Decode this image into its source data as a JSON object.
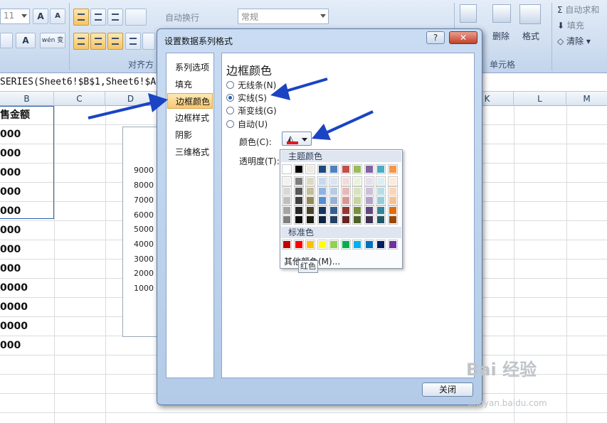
{
  "ribbon": {
    "font_size": "11",
    "wrap_text": "自动换行",
    "number_format": "常规",
    "align_group": "对齐方",
    "cells_group": "单元格",
    "delete_label": "删除",
    "format_label": "格式",
    "autosum_label": "自动求和",
    "fill_label": "填充",
    "clear_label": "清除",
    "sigma_icon": "Σ",
    "font_a": "A",
    "phonetic": "wén 变"
  },
  "formula_bar": {
    "text": "SERIES(Sheet6!$B$1,Sheet6!$A"
  },
  "columns": [
    "B",
    "C",
    "D",
    "K",
    "L",
    "M"
  ],
  "sheet_cells": [
    "售金额",
    "000",
    "000",
    "000",
    "000",
    "000",
    "000",
    "000",
    "000",
    "0000",
    "0000",
    "0000",
    "000"
  ],
  "chart_ticks": [
    "9000",
    "8000",
    "7000",
    "6000",
    "5000",
    "4000",
    "3000",
    "2000",
    "1000"
  ],
  "dialog": {
    "title": "设置数据系列格式",
    "help": "?",
    "close": "✕",
    "nav": [
      "系列选项",
      "填充",
      "边框颜色",
      "边框样式",
      "阴影",
      "三维格式"
    ],
    "nav_active_index": 2,
    "section_title": "边框颜色",
    "options": [
      "无线条(N)",
      "实线(S)",
      "渐变线(G)",
      "自动(U)"
    ],
    "selected_option_index": 1,
    "color_label": "颜色(C):",
    "transparency_label": "透明度(T):",
    "close_button": "关闭"
  },
  "palette": {
    "theme_title": "主题颜色",
    "standard_title": "标准色",
    "more_colors": "其他颜色(M)...",
    "tooltip": "红色",
    "selected_color": "#e6151f",
    "theme_top": [
      "#ffffff",
      "#000000",
      "#eeece1",
      "#1f497d",
      "#4f81bd",
      "#c0504d",
      "#9bbb59",
      "#8064a2",
      "#4bacc6",
      "#f79646"
    ],
    "theme_shades": [
      [
        "#f2f2f2",
        "#7f7f7f",
        "#ddd9c3",
        "#c6d9f0",
        "#dbe5f1",
        "#f2dcdb",
        "#ebf1dd",
        "#e5e0ec",
        "#dbeef3",
        "#fdeada"
      ],
      [
        "#d8d8d8",
        "#595959",
        "#c4bd97",
        "#8db3e2",
        "#b8cce4",
        "#e5b9b7",
        "#d7e3bc",
        "#ccc1d9",
        "#b7dde8",
        "#fbd5b5"
      ],
      [
        "#bfbfbf",
        "#3f3f3f",
        "#938953",
        "#548dd4",
        "#95b3d7",
        "#d99694",
        "#c3d69b",
        "#b2a2c7",
        "#92cddc",
        "#fac08f"
      ],
      [
        "#a5a5a5",
        "#262626",
        "#494429",
        "#17365d",
        "#366092",
        "#953734",
        "#76923c",
        "#5f497a",
        "#31859b",
        "#e36c09"
      ],
      [
        "#7f7f7f",
        "#0c0c0c",
        "#1d1b10",
        "#0f243e",
        "#244061",
        "#632423",
        "#4f6128",
        "#3f3151",
        "#205867",
        "#974806"
      ]
    ],
    "standard": [
      "#c00000",
      "#ff0000",
      "#ffc000",
      "#ffff00",
      "#92d050",
      "#00b050",
      "#00b0f0",
      "#0070c0",
      "#002060",
      "#7030a0"
    ]
  },
  "watermark": {
    "brand": "Bai 经验",
    "url": "jingyan.baidu.com"
  },
  "colors": {
    "arrow": "#1a44c2",
    "active_nav": "#f8c870"
  }
}
